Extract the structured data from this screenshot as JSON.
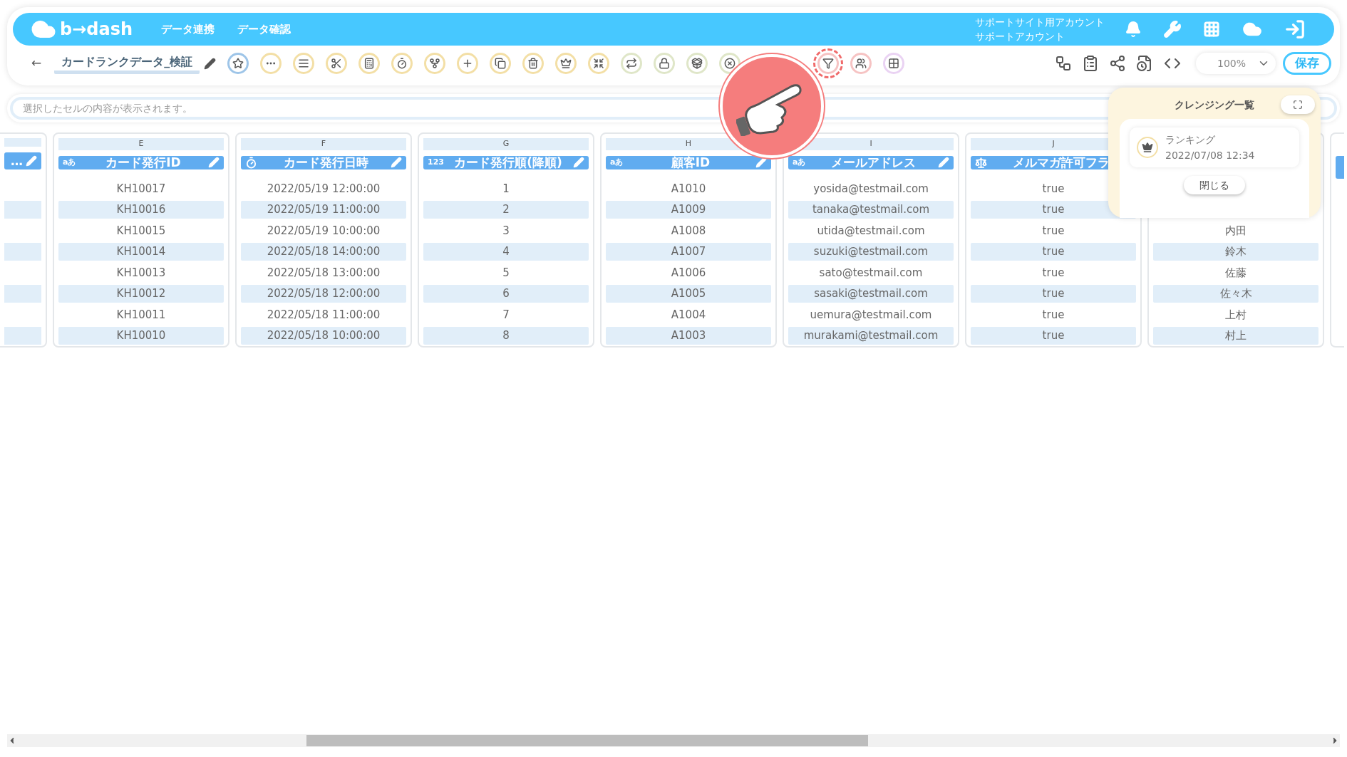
{
  "header": {
    "logo": "b→dash",
    "nav": [
      "データ連携",
      "データ確認"
    ],
    "account": [
      "サポートサイト用アカウント",
      "サポートアカウント"
    ]
  },
  "toolbar": {
    "back": "←",
    "title": "カードランクデータ_検証",
    "tools": [
      {
        "kind": "star",
        "color": "#9ec5e8",
        "highlighted": false
      },
      {
        "kind": "dots",
        "color": "#f3dfa6",
        "highlighted": false
      },
      {
        "kind": "lines",
        "color": "#f3dfa6",
        "highlighted": false
      },
      {
        "kind": "scissors",
        "color": "#f3dfa6",
        "highlighted": false
      },
      {
        "kind": "calc",
        "color": "#f3dfa6",
        "highlighted": false
      },
      {
        "kind": "timer",
        "color": "#f3dfa6",
        "highlighted": false
      },
      {
        "kind": "fork",
        "color": "#f3dfa6",
        "highlighted": false
      },
      {
        "kind": "plus",
        "color": "#f3dfa6",
        "highlighted": false
      },
      {
        "kind": "copy",
        "color": "#f3dfa6",
        "highlighted": false
      },
      {
        "kind": "trash",
        "color": "#f3dfa6",
        "highlighted": false
      },
      {
        "kind": "crown",
        "color": "#f3dfa6",
        "highlighted": false
      },
      {
        "kind": "shrink",
        "color": "#f3dfa6",
        "highlighted": false
      },
      {
        "kind": "repeat",
        "color": "#dfe6c8",
        "highlighted": false
      },
      {
        "kind": "lock",
        "color": "#dfe6c8",
        "highlighted": false
      },
      {
        "kind": "upload",
        "color": "#dfe6c8",
        "highlighted": false
      },
      {
        "kind": "cancel",
        "color": "#dfe6c8",
        "highlighted": false
      },
      {
        "kind": "filter",
        "color": "#f6c3c3",
        "highlighted": true
      },
      {
        "kind": "people",
        "color": "#f6c3c3",
        "highlighted": false
      },
      {
        "kind": "grid",
        "color": "#ead3f3",
        "highlighted": false
      }
    ],
    "zoom": "100%",
    "save": "保存"
  },
  "cell_bar": {
    "placeholder": "選択したセルの内容が表示されます。"
  },
  "columns": [
    {
      "title": "…",
      "kind": "partial"
    },
    {
      "letter": "E",
      "title": "カード発行ID",
      "kind": "text",
      "type_label": "aあ",
      "values": [
        "KH10017",
        "KH10016",
        "KH10015",
        "KH10014",
        "KH10013",
        "KH10012",
        "KH10011",
        "KH10010"
      ]
    },
    {
      "letter": "F",
      "title": "カード発行日時",
      "kind": "datetime",
      "values": [
        "2022/05/19 12:00:00",
        "2022/05/19 11:00:00",
        "2022/05/19 10:00:00",
        "2022/05/18 14:00:00",
        "2022/05/18 13:00:00",
        "2022/05/18 12:00:00",
        "2022/05/18 11:00:00",
        "2022/05/18 10:00:00"
      ]
    },
    {
      "letter": "G",
      "title": "カード発行順(降順)",
      "kind": "number",
      "type_label": "123",
      "values": [
        "1",
        "2",
        "3",
        "4",
        "5",
        "6",
        "7",
        "8"
      ]
    },
    {
      "letter": "H",
      "title": "顧客ID",
      "kind": "text",
      "type_label": "aあ",
      "values": [
        "A1010",
        "A1009",
        "A1008",
        "A1007",
        "A1006",
        "A1005",
        "A1004",
        "A1003"
      ]
    },
    {
      "letter": "I",
      "title": "メールアドレス",
      "kind": "text",
      "type_label": "aあ",
      "values": [
        "yosida@testmail.com",
        "tanaka@testmail.com",
        "utida@testmail.com",
        "suzuki@testmail.com",
        "sato@testmail.com",
        "sasaki@testmail.com",
        "uemura@testmail.com",
        "murakami@testmail.com"
      ]
    },
    {
      "letter": "J",
      "title": "メルマガ許可フラ",
      "kind": "boolean",
      "values": [
        "true",
        "true",
        "true",
        "true",
        "true",
        "true",
        "true",
        "true"
      ]
    },
    {
      "kind": "covered",
      "values": [
        "内田",
        "鈴木",
        "佐藤",
        "佐々木",
        "上村",
        "村上"
      ]
    }
  ],
  "cleansing_panel": {
    "title": "クレンジング一覧",
    "items": [
      {
        "name": "ランキング",
        "date": "2022/07/08 12:34"
      }
    ],
    "close": "閉じる"
  }
}
